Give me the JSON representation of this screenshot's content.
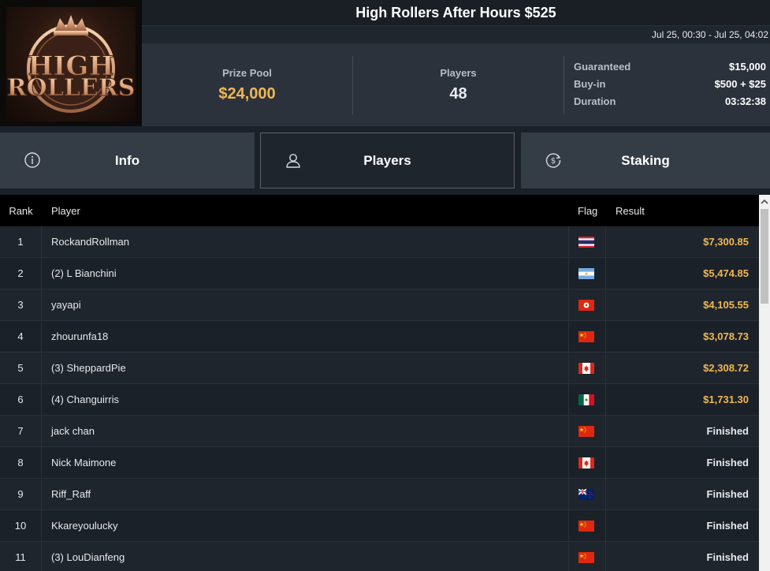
{
  "header": {
    "title": "High Rollers After Hours $525",
    "date_range": "Jul 25, 00:30 - Jul 25, 04:02",
    "logo_text": "HIGH ROLLERS"
  },
  "stats": {
    "prize_pool_label": "Prize Pool",
    "prize_pool_value": "$24,000",
    "players_label": "Players",
    "players_value": "48"
  },
  "details": [
    {
      "label": "Guaranteed",
      "value": "$15,000"
    },
    {
      "label": "Buy-in",
      "value": "$500 + $25"
    },
    {
      "label": "Duration",
      "value": "03:32:38"
    }
  ],
  "tabs": [
    {
      "label": "Info",
      "icon": "info-icon"
    },
    {
      "label": "Players",
      "icon": "user-icon",
      "active": true
    },
    {
      "label": "Staking",
      "icon": "staking-dollar-icon"
    }
  ],
  "table": {
    "columns": [
      "Rank",
      "Player",
      "Flag",
      "Result"
    ],
    "rows": [
      {
        "rank": "1",
        "player": "RockandRollman",
        "flag": "thailand",
        "result": "$7,300.85",
        "paid": true
      },
      {
        "rank": "2",
        "player": "(2) L Bianchini",
        "flag": "argentina",
        "result": "$5,474.85",
        "paid": true
      },
      {
        "rank": "3",
        "player": "yayapi",
        "flag": "hong-kong",
        "result": "$4,105.55",
        "paid": true
      },
      {
        "rank": "4",
        "player": "zhourunfa18",
        "flag": "china",
        "result": "$3,078.73",
        "paid": true
      },
      {
        "rank": "5",
        "player": "(3) SheppardPie",
        "flag": "canada",
        "result": "$2,308.72",
        "paid": true
      },
      {
        "rank": "6",
        "player": "(4) Changuirris",
        "flag": "mexico",
        "result": "$1,731.30",
        "paid": true
      },
      {
        "rank": "7",
        "player": "jack chan",
        "flag": "china",
        "result": "Finished",
        "paid": false
      },
      {
        "rank": "8",
        "player": "Nick Maimone",
        "flag": "canada",
        "result": "Finished",
        "paid": false
      },
      {
        "rank": "9",
        "player": "Riff_Raff",
        "flag": "new-zealand",
        "result": "Finished",
        "paid": false
      },
      {
        "rank": "10",
        "player": "Kkareyoulucky",
        "flag": "china",
        "result": "Finished",
        "paid": false
      },
      {
        "rank": "11",
        "player": "(3) LouDianfeng",
        "flag": "china",
        "result": "Finished",
        "paid": false
      }
    ]
  },
  "colors": {
    "accent_gold": "#f0b755",
    "background": "#1b2129",
    "panel": "#2b323c"
  }
}
